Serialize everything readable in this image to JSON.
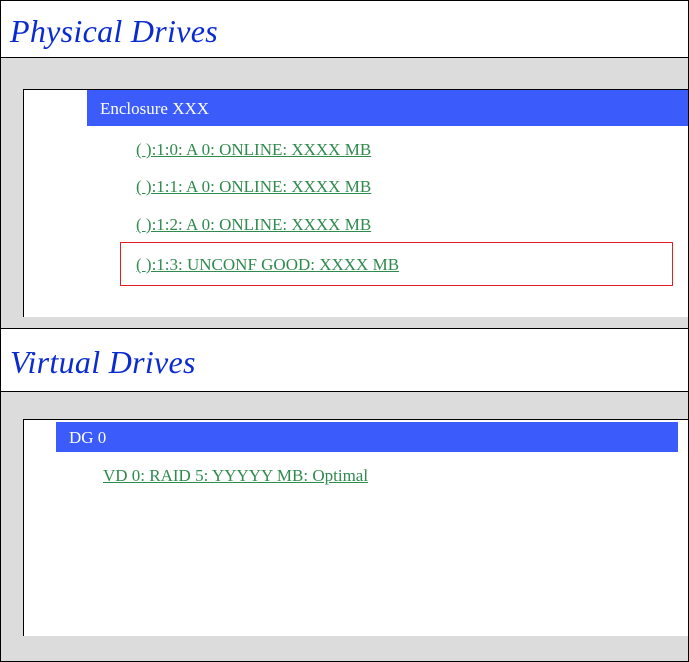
{
  "physical": {
    "title": "Physical Drives",
    "enclosure_label": "Enclosure XXX",
    "drives": [
      "( ):1:0: A 0: ONLINE: XXXX MB",
      "( ):1:1: A 0: ONLINE: XXXX MB",
      "( ):1:2: A 0: ONLINE: XXXX MB",
      "( ):1:3: UNCONF GOOD: XXXX MB"
    ],
    "highlighted_index": 3
  },
  "virtual": {
    "title": "Virtual Drives",
    "group_label": "DG 0",
    "drives": [
      "VD 0: RAID 5: YYYYY MB: Optimal"
    ]
  },
  "colors": {
    "title": "#0a2bd0",
    "bar": "#3b5bfb",
    "link": "#2f8a4e",
    "highlight": "#e02020",
    "panel_bg": "#dcdcdc"
  }
}
